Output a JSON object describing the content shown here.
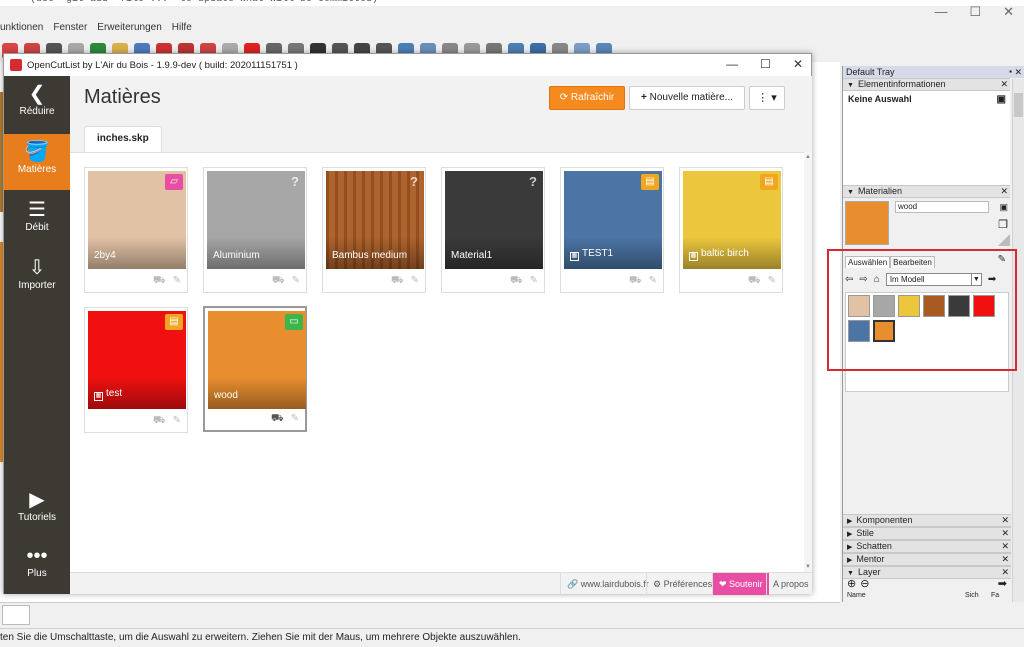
{
  "background_app": {
    "menu": [
      "unktionen",
      "Fenster",
      "Erweiterungen",
      "Hilfe"
    ],
    "window_controls": [
      "—",
      "☐",
      "✕"
    ],
    "status_text": "ten Sie die Umschalttaste, um die Auswahl zu erweitern. Ziehen Sie mit der Maus, um mehrere Objekte auszuwählen."
  },
  "ocl": {
    "title": "OpenCutList by L'Air du Bois - 1.9.9-dev ( build: 202011151751 )",
    "window_controls": [
      "—",
      "☐",
      "✕"
    ],
    "sidebar": {
      "reduce": "Réduire",
      "materials": "Matières",
      "cutlist": "Débit",
      "import": "Importer",
      "tutorials": "Tutoriels",
      "more": "Plus"
    },
    "page_title": "Matières",
    "refresh_label": "Rafraîchir",
    "new_material_label": "Nouvelle matière...",
    "more_menu_icon": "⋮ ▾",
    "file_tab": "inches.skp",
    "materials": [
      {
        "name": "2by4",
        "badge": "sheet",
        "color": "#e2c2a4",
        "badge_color": "#e84fa4",
        "textured": false
      },
      {
        "name": "Aluminium",
        "badge": "unknown",
        "color": "#a7a7a7",
        "textured": false
      },
      {
        "name": "Bambus medium",
        "badge": "unknown",
        "color": "#a85a22",
        "textured": false
      },
      {
        "name": "Material1",
        "badge": "unknown",
        "color": "#3a3a3a",
        "textured": false
      },
      {
        "name": "TEST1",
        "badge": "solid-wood",
        "color": "#4c75a5",
        "badge_color": "#f0a71f",
        "textured": true
      },
      {
        "name": "baltic birch",
        "badge": "solid-wood",
        "color": "#ecc73e",
        "badge_color": "#f0a71f",
        "textured": true
      },
      {
        "name": "test",
        "badge": "solid-wood",
        "color": "#f01010",
        "badge_color": "#f0a71f",
        "textured": true
      },
      {
        "name": "wood",
        "badge": "dimensional",
        "color": "#e88e2f",
        "badge_color": "#3cb54a",
        "textured": false
      }
    ],
    "footer": {
      "website": "www.lairdubois.fr",
      "preferences": "Préférences",
      "support": "Soutenir",
      "about": "A propos"
    }
  },
  "tray": {
    "title": "Default Tray",
    "entity_info": {
      "heading": "Elementinformationen",
      "value": "Keine Auswahl"
    },
    "materials": {
      "heading": "Materialien",
      "current_name": "wood",
      "current_color": "#e88e2f",
      "tabs": [
        "Auswählen",
        "Bearbeiten"
      ],
      "collection": "Im Modell",
      "swatches": [
        "#e2c2a4",
        "#a7a7a7",
        "#ecc73e",
        "#a85a22",
        "#3a3a3a",
        "#f01010",
        "#4c75a5",
        "#e88e2f"
      ]
    },
    "panels": [
      "Komponenten",
      "Stile",
      "Schatten",
      "Mentor",
      "Layer"
    ],
    "layer_columns": [
      "Name",
      "Sich",
      "Fa"
    ]
  }
}
